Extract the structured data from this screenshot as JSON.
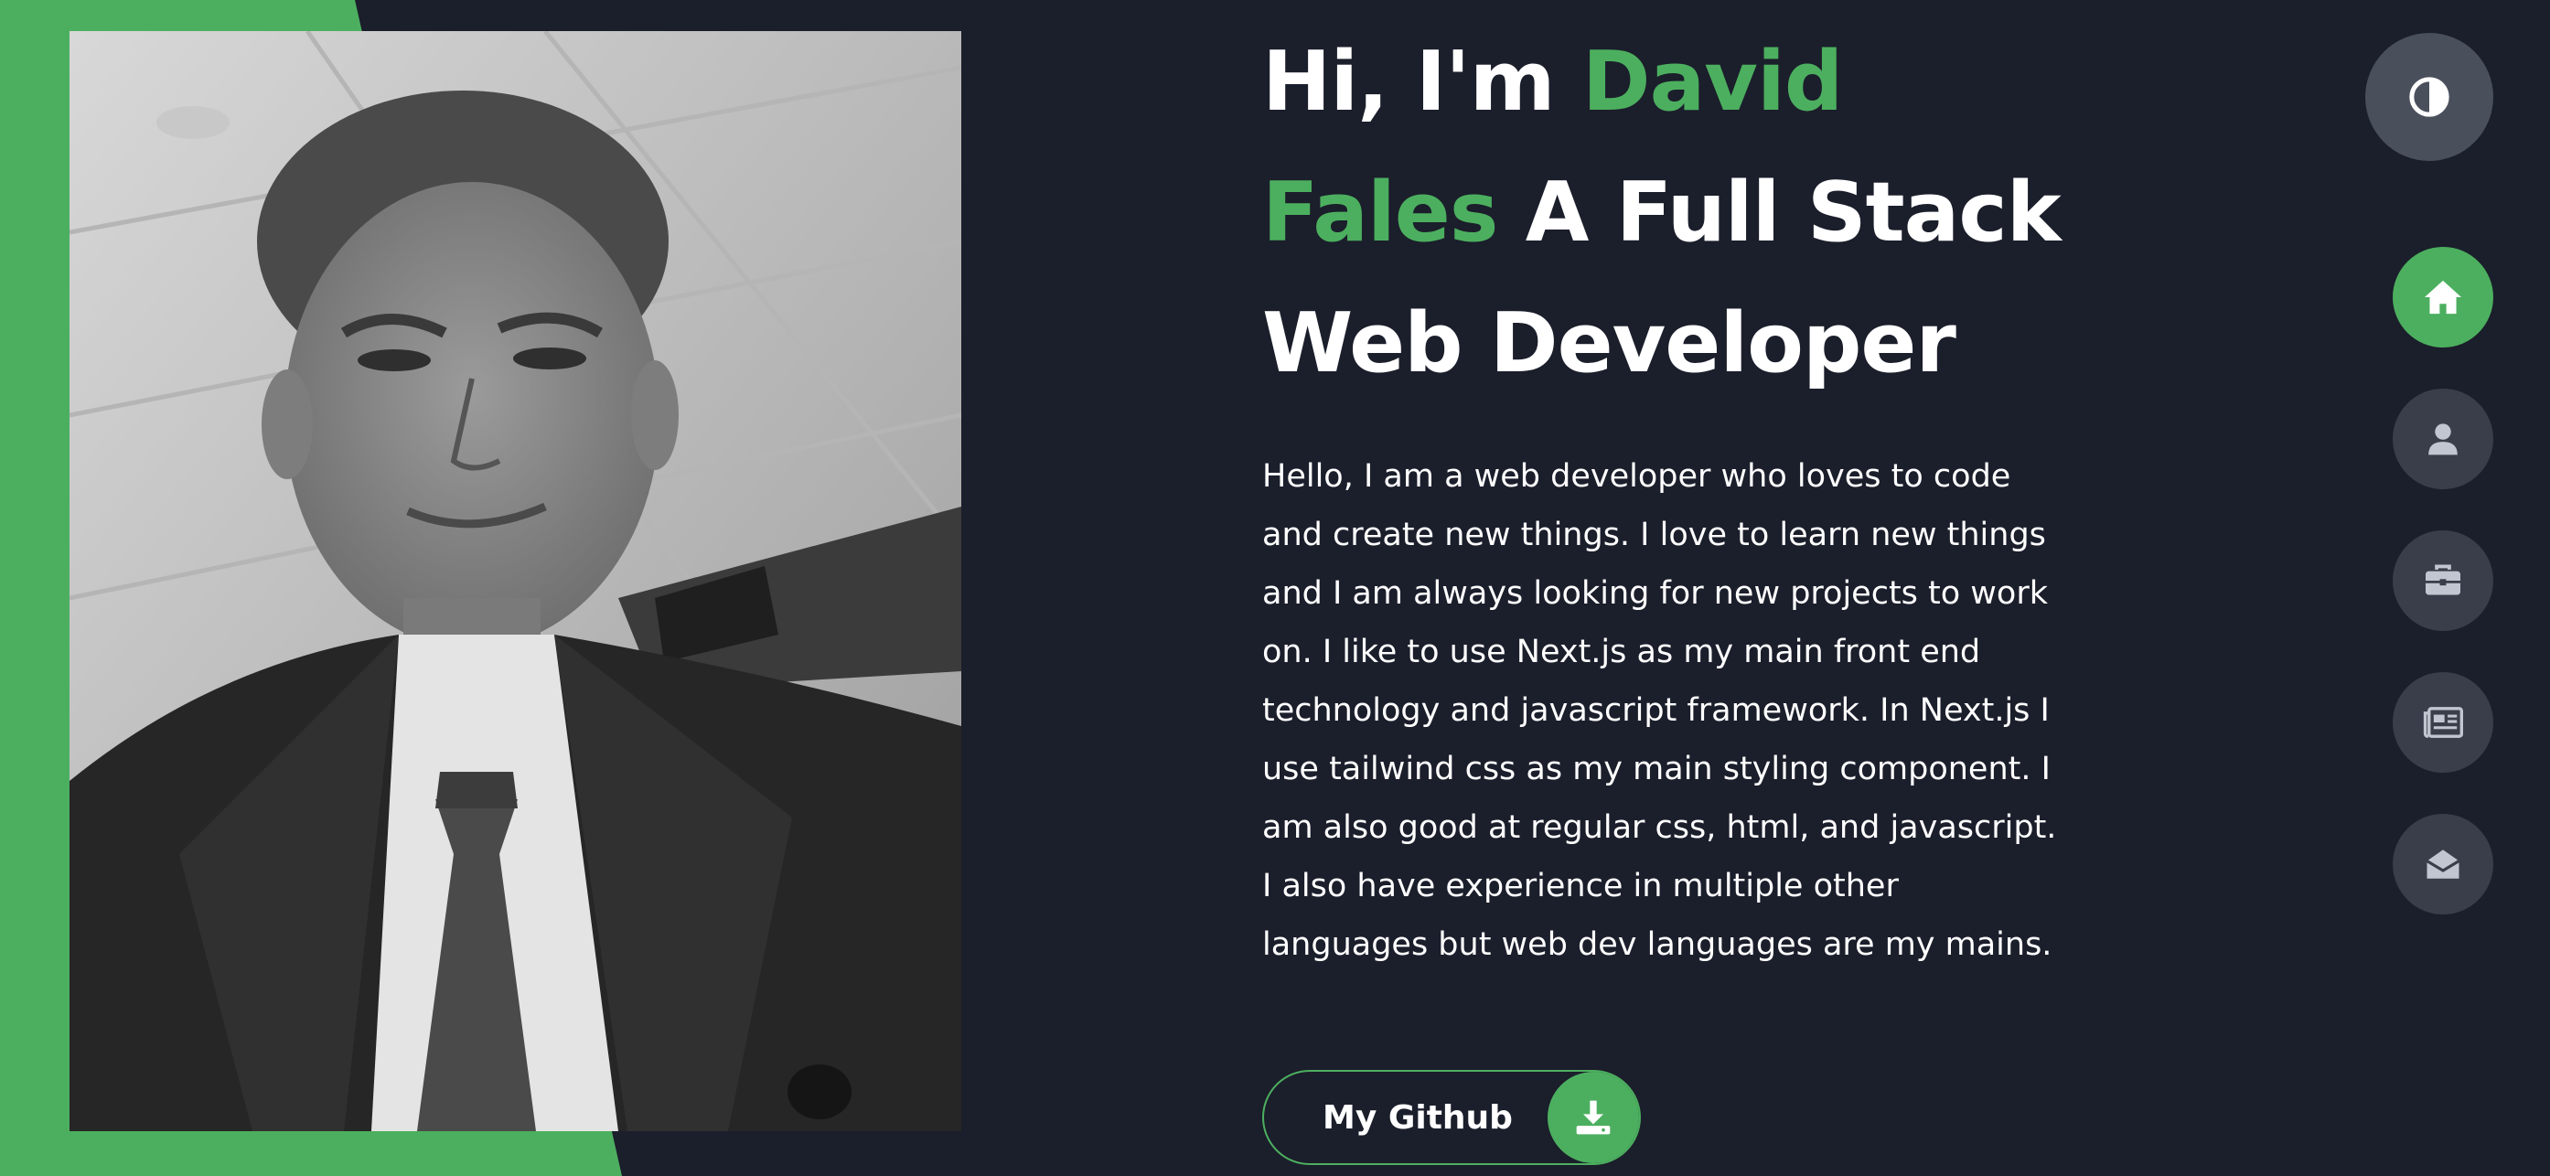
{
  "hero": {
    "greeting": "Hi, I'm ",
    "name": "David Fales",
    "role": " A Full Stack Web Developer",
    "intro": "Hello, I am a web developer who loves to code and create new things. I love to learn new things and I am always looking for new projects to work on. I like to use Next.js as my main front end technology and javascript framework. In Next.js I use tailwind css as my main styling component. I am also good at regular css, html, and javascript. I also have experience in multiple other languages but web dev languages are my mains."
  },
  "button": {
    "github_label": "My Github",
    "github_icon": "download-icon"
  },
  "nav": {
    "theme_icon": "contrast-icon",
    "items": [
      {
        "icon": "home-icon",
        "active": true
      },
      {
        "icon": "user-icon",
        "active": false
      },
      {
        "icon": "briefcase-icon",
        "active": false
      },
      {
        "icon": "newspaper-icon",
        "active": false
      },
      {
        "icon": "envelope-open-icon",
        "active": false
      }
    ]
  },
  "colors": {
    "background": "#1b1e2b",
    "accent": "#4caf5f",
    "nav_button": "#3a3e4b",
    "nav_icon": "#c2c6d0",
    "text": "#ffffff"
  }
}
